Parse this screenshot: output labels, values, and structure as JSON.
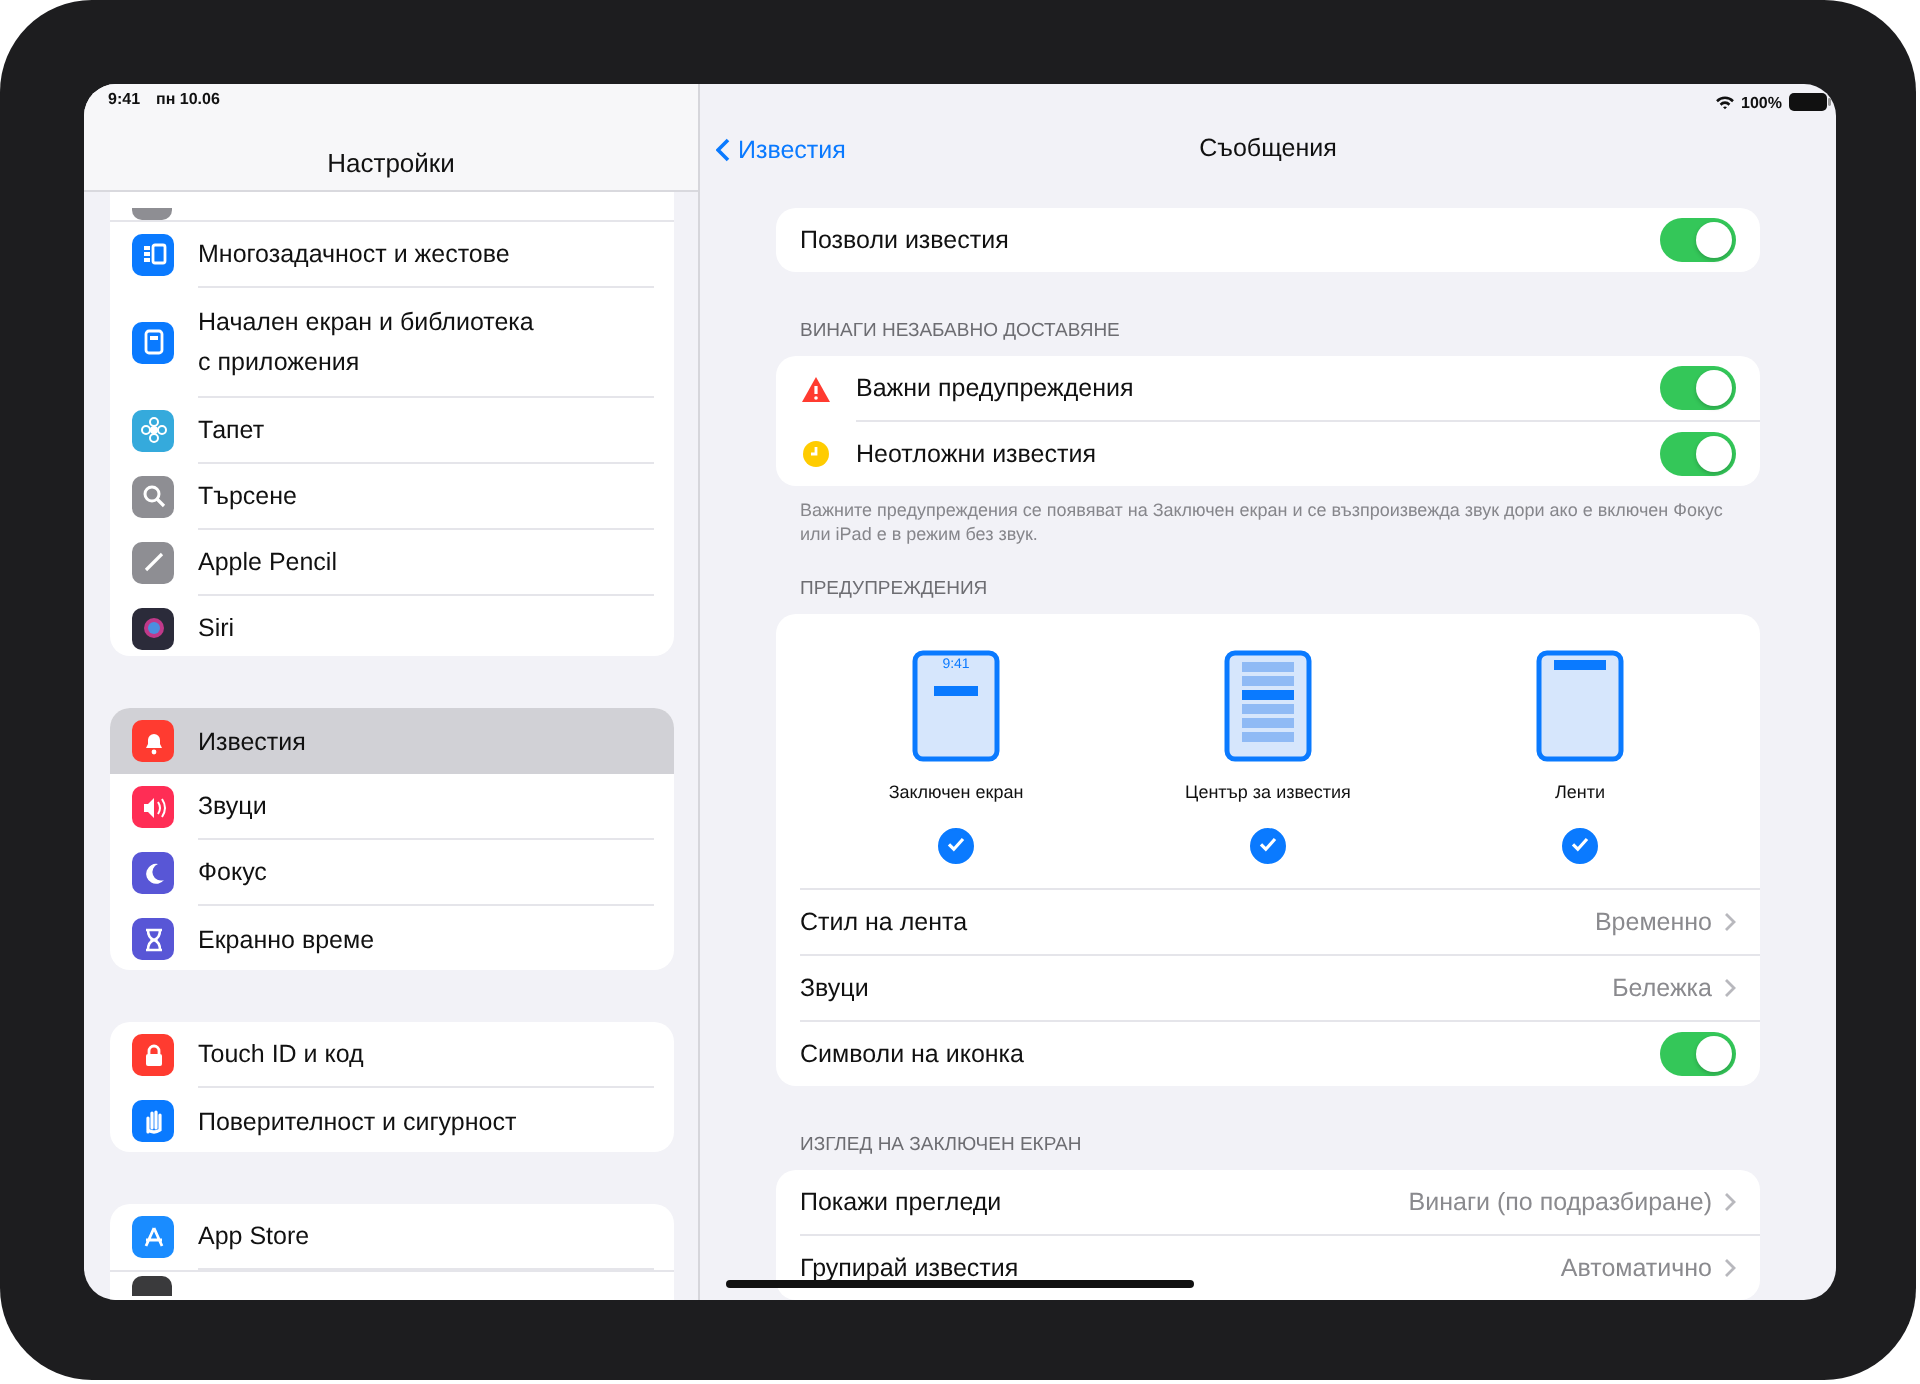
{
  "sidebar": {
    "status": {
      "time": "9:41",
      "date": "пн 10.06"
    },
    "title": "Настройки",
    "groups": [
      {
        "clipped_top": true,
        "items": [
          {
            "label": "Многозадачност и жестове",
            "color": "#0a7aff",
            "selected": false
          },
          {
            "label": "Начален екран и библиотека с приложения",
            "color": "#0a7aff",
            "selected": false
          },
          {
            "label": "Тапет",
            "color": "#35aadc",
            "selected": false
          },
          {
            "label": "Търсене",
            "color": "#8e8e93",
            "selected": false
          },
          {
            "label": "Apple Pencil",
            "color": "#8e8e93",
            "selected": false
          },
          {
            "label": "Siri",
            "color": "#2b2b3a",
            "selected": false
          }
        ]
      },
      {
        "items": [
          {
            "label": "Известия",
            "color": "#ff3b30",
            "selected": true
          },
          {
            "label": "Звуци",
            "color": "#ff2d55",
            "selected": false
          },
          {
            "label": "Фокус",
            "color": "#5856d6",
            "selected": false
          },
          {
            "label": "Екранно време",
            "color": "#5856d6",
            "selected": false
          }
        ]
      },
      {
        "items": [
          {
            "label": "Touch ID и код",
            "color": "#ff3b30",
            "selected": false
          },
          {
            "label": "Поверителност и сигурност",
            "color": "#0a7aff",
            "selected": false
          }
        ]
      },
      {
        "clipped_bottom": true,
        "items": [
          {
            "label": "App Store",
            "color": "#1a8cff",
            "selected": false
          }
        ]
      }
    ]
  },
  "detail": {
    "status": {
      "battery": "100%"
    },
    "back": "Известия",
    "title": "Съобщения",
    "sections": [
      {
        "rows": [
          {
            "kind": "toggle",
            "label": "Позволи известия",
            "on": true
          }
        ]
      },
      {
        "header": "ВИНАГИ НЕЗАБАВНО ДОСТАВЯНЕ",
        "footer": "Важните предупреждения се появяват на Заключен екран и се възпроизвежда звук дори ако е включен Фокус или iPad е в режим без звук.",
        "rows": [
          {
            "kind": "toggle",
            "label": "Важни предупреждения",
            "on": true,
            "color": "#ff3b30"
          },
          {
            "kind": "toggle",
            "label": "Неотложни известия",
            "on": true,
            "color": "#ffcc00"
          }
        ]
      },
      {
        "header": "ПРЕДУПРЕЖДЕНИЯ",
        "rows": [
          {
            "kind": "styles",
            "options": [
              {
                "label": "Заключен екран",
                "checked": true,
                "screen_text": "9:41"
              },
              {
                "label": "Център за известия",
                "checked": true
              },
              {
                "label": "Ленти",
                "checked": true
              }
            ]
          },
          {
            "kind": "link",
            "label": "Стил на лента",
            "value": "Временно"
          },
          {
            "kind": "link",
            "label": "Звуци",
            "value": "Бележка"
          },
          {
            "kind": "toggle",
            "label": "Символи на иконка",
            "on": true
          }
        ]
      },
      {
        "header": "ИЗГЛЕД НА ЗАКЛЮЧЕН ЕКРАН",
        "rows": [
          {
            "kind": "link",
            "label": "Покажи прегледи",
            "value": "Винаги (по подразбиране)"
          },
          {
            "kind": "link",
            "label": "Групирай известия",
            "value": "Автоматично"
          }
        ]
      }
    ]
  }
}
